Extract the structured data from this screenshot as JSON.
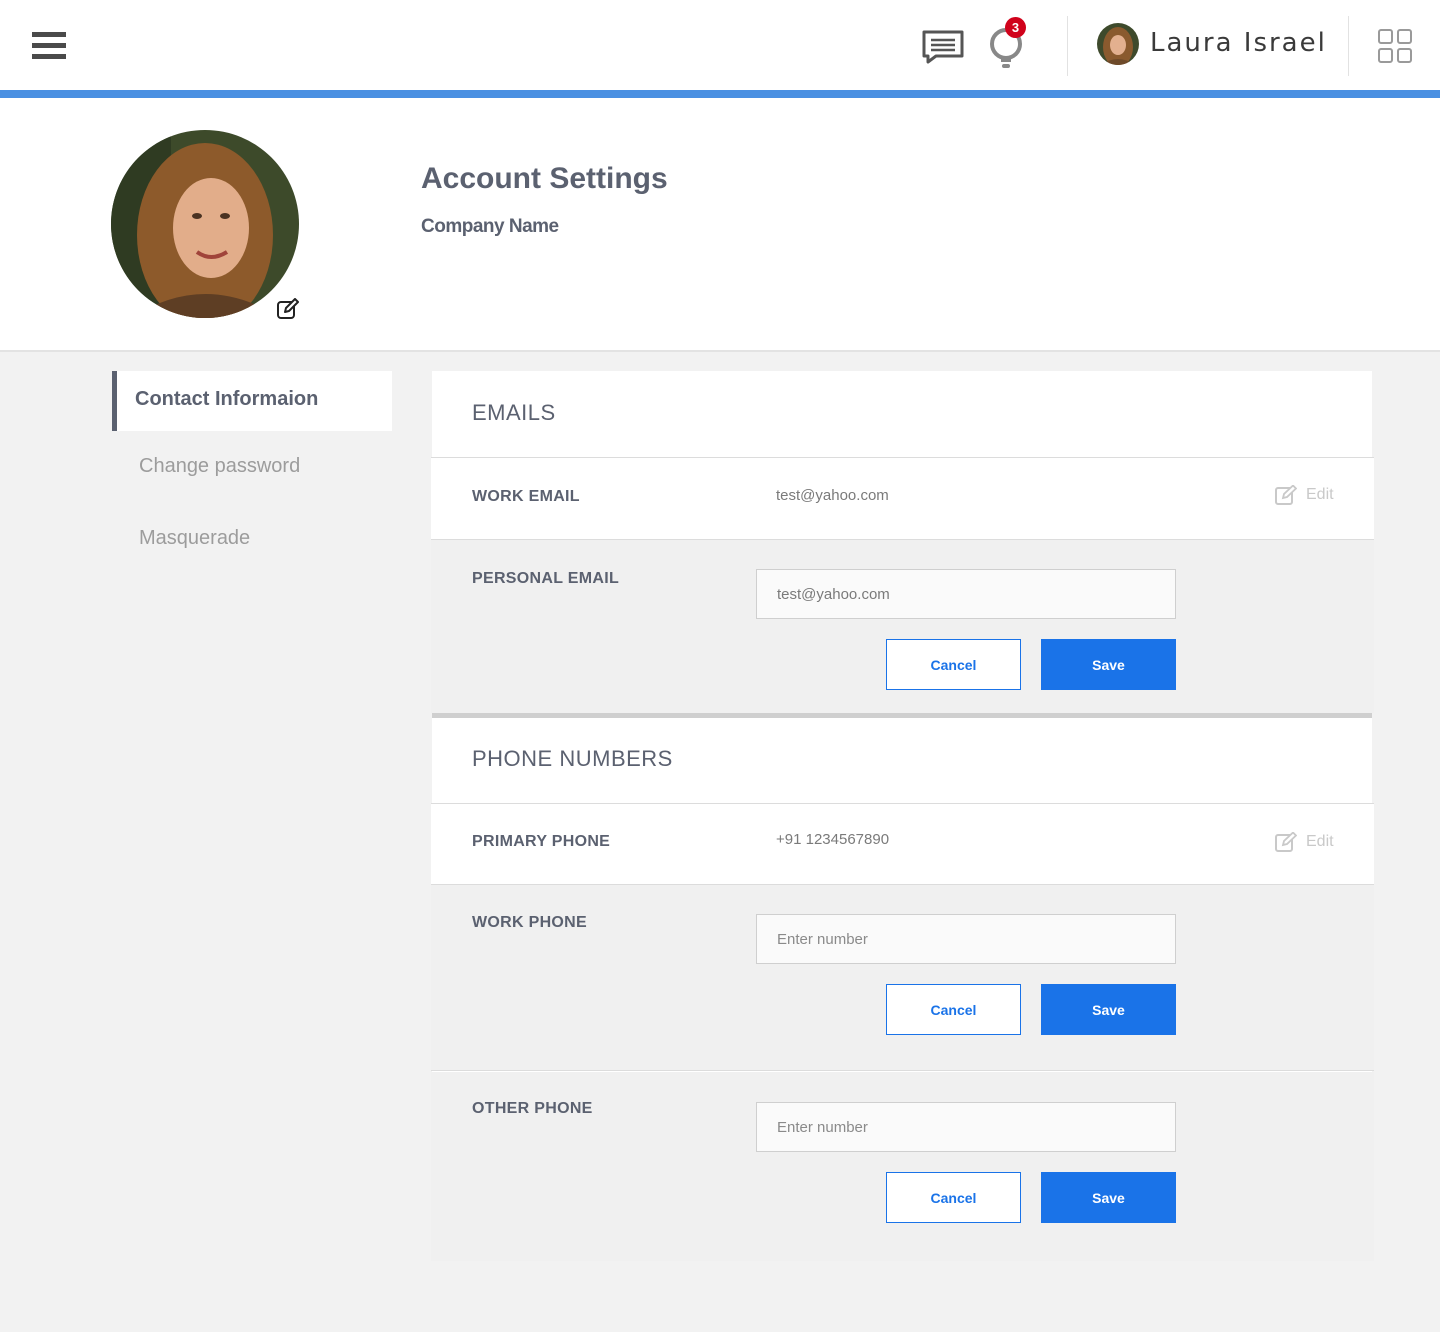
{
  "header": {
    "user_name": "Laura Israel",
    "notification_count": "3",
    "accent_color": "#4a90e2",
    "icons": [
      "hamburger-menu-icon",
      "chat-icon",
      "lightbulb-icon",
      "apps-grid-icon"
    ]
  },
  "profile": {
    "title": "Account Settings",
    "company": "Company Name"
  },
  "sidebar": {
    "items": [
      {
        "label": "Contact Informaion",
        "active": true
      },
      {
        "label": "Change password",
        "active": false
      },
      {
        "label": "Masquerade",
        "active": false
      }
    ]
  },
  "emails": {
    "title": "EMAILS",
    "work": {
      "label": "WORK EMAIL",
      "value": "test@yahoo.com",
      "edit_label": "Edit"
    },
    "personal": {
      "label": "PERSONAL EMAIL",
      "value": "test@yahoo.com",
      "cancel_label": "Cancel",
      "save_label": "Save"
    }
  },
  "phones": {
    "title": "PHONE NUMBERS",
    "primary": {
      "label": "PRIMARY PHONE",
      "value": "+91 1234567890",
      "edit_label": "Edit"
    },
    "work": {
      "label": "WORK PHONE",
      "placeholder": "Enter number",
      "cancel_label": "Cancel",
      "save_label": "Save"
    },
    "other": {
      "label": "OTHER PHONE",
      "placeholder": "Enter number",
      "cancel_label": "Cancel",
      "save_label": "Save"
    }
  },
  "colors": {
    "primary_button": "#1a73e8",
    "text": "#5b6170",
    "badge": "#d0021b"
  }
}
